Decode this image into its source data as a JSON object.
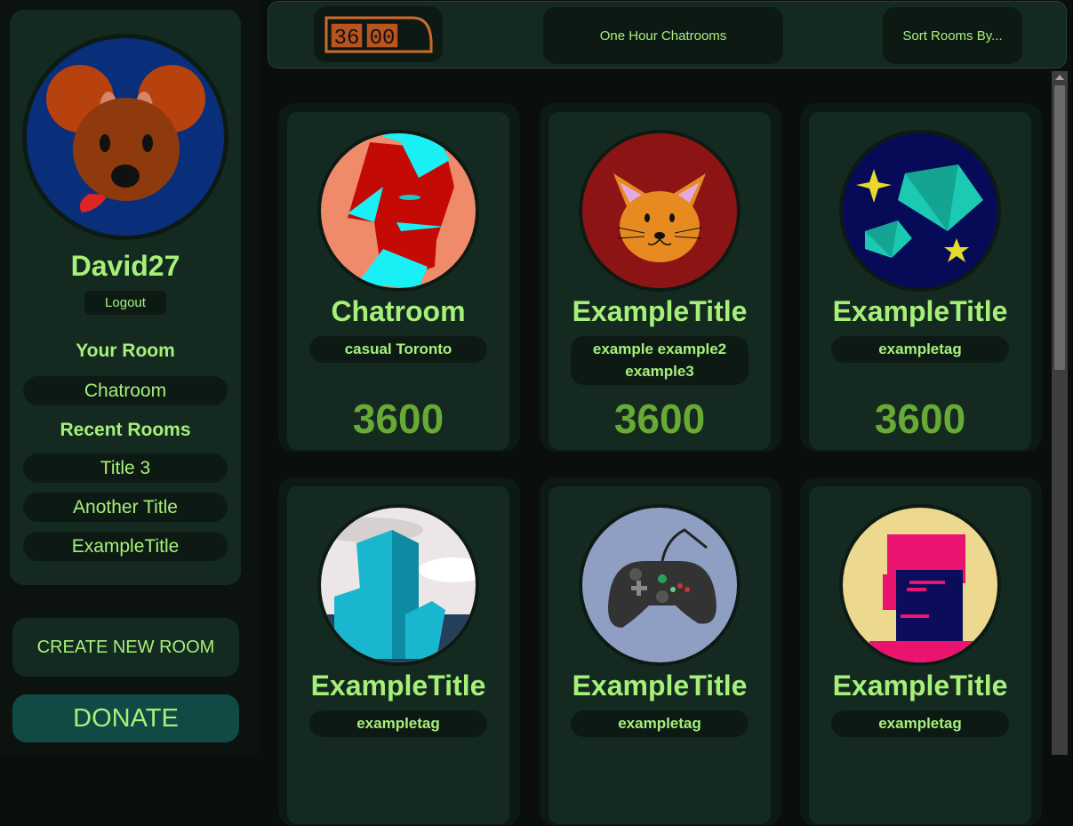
{
  "sidebar": {
    "username": "David27",
    "logout_label": "Logout",
    "your_room_heading": "Your Room",
    "your_room": "Chatroom",
    "recent_heading": "Recent Rooms",
    "recent_rooms": [
      "Title 3",
      "Another Title",
      "ExampleTitle"
    ],
    "create_label": "CREATE NEW ROOM",
    "donate_label": "DONATE"
  },
  "header": {
    "timer_hours": "36",
    "timer_minutes": "00",
    "title": "One Hour Chatrooms",
    "sort_label": "Sort Rooms By..."
  },
  "rooms": [
    {
      "title": "Chatroom",
      "tags": "casual Toronto",
      "count": "3600",
      "image": "abstract-face"
    },
    {
      "title": "ExampleTitle",
      "tags": "example example2 example3",
      "count": "3600",
      "image": "cat"
    },
    {
      "title": "ExampleTitle",
      "tags": "exampletag",
      "count": "3600",
      "image": "diamonds"
    },
    {
      "title": "ExampleTitle",
      "tags": "exampletag",
      "count": "",
      "image": "buildings"
    },
    {
      "title": "ExampleTitle",
      "tags": "exampletag",
      "count": "",
      "image": "gamepad"
    },
    {
      "title": "ExampleTitle",
      "tags": "exampletag",
      "count": "",
      "image": "robot-head"
    }
  ],
  "colors": {
    "accent_text": "#a6f07a",
    "count_text": "#69a935",
    "panel": "#142a20",
    "panel_dark": "#0d1a14",
    "donate": "#114a45",
    "timer": "#cf6b2a"
  }
}
